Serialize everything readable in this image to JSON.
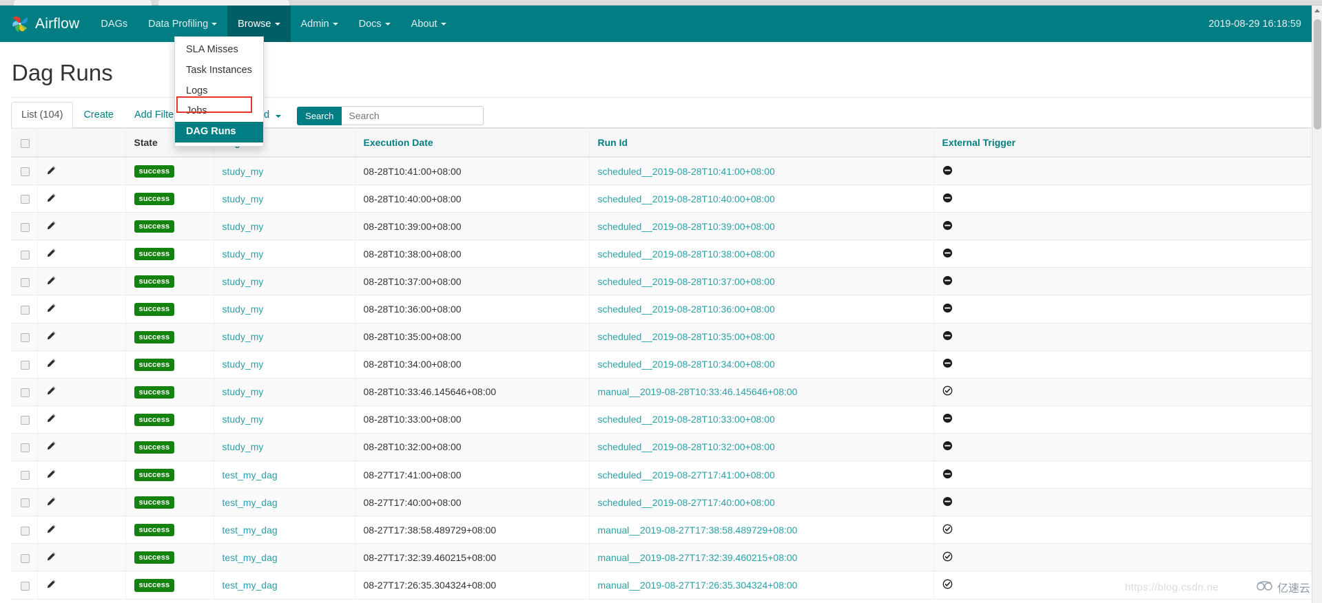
{
  "navbar": {
    "brand": "Airflow",
    "items": [
      {
        "label": "DAGs",
        "caret": false
      },
      {
        "label": "Data Profiling",
        "caret": true
      },
      {
        "label": "Browse",
        "caret": true,
        "open": true
      },
      {
        "label": "Admin",
        "caret": true
      },
      {
        "label": "Docs",
        "caret": true
      },
      {
        "label": "About",
        "caret": true
      }
    ],
    "clock": "2019-08-29 16:18:59",
    "brand_color": "#017e84",
    "brand_open_color": "#005f66"
  },
  "dropdown": {
    "items": [
      {
        "label": "SLA Misses",
        "active": false
      },
      {
        "label": "Task Instances",
        "active": false
      },
      {
        "label": "Logs",
        "active": false
      },
      {
        "label": "Jobs",
        "active": false
      },
      {
        "label": "DAG Runs",
        "active": true
      }
    ],
    "highlight_color": "#e8352c"
  },
  "page": {
    "title": "Dag Runs"
  },
  "toolbar": {
    "tabs": [
      {
        "label": "List (104)",
        "active": true,
        "caret": false
      },
      {
        "label": "Create",
        "active": false,
        "caret": false
      },
      {
        "label": "Add Filter",
        "active": false,
        "caret": true
      },
      {
        "label": "With selected",
        "active": false,
        "caret": true
      }
    ],
    "search_button_label": "Search",
    "search_placeholder": "Search",
    "search_value": ""
  },
  "table": {
    "columns": [
      {
        "key": "check",
        "label": "",
        "sortable": false
      },
      {
        "key": "edit",
        "label": "",
        "sortable": false
      },
      {
        "key": "state",
        "label": "State",
        "sortable": false
      },
      {
        "key": "dag_id",
        "label": "Dag Id",
        "sortable": true
      },
      {
        "key": "execution_date",
        "label": "Execution Date",
        "sortable": true
      },
      {
        "key": "run_id",
        "label": "Run Id",
        "sortable": true
      },
      {
        "key": "external_trigger",
        "label": "External Trigger",
        "sortable": true
      }
    ],
    "rows": [
      {
        "state": "success",
        "dag_id": "study_my",
        "execution_date": "08-28T10:41:00+08:00",
        "run_id": "scheduled__2019-08-28T10:41:00+08:00",
        "external_trigger": "false"
      },
      {
        "state": "success",
        "dag_id": "study_my",
        "execution_date": "08-28T10:40:00+08:00",
        "run_id": "scheduled__2019-08-28T10:40:00+08:00",
        "external_trigger": "false"
      },
      {
        "state": "success",
        "dag_id": "study_my",
        "execution_date": "08-28T10:39:00+08:00",
        "run_id": "scheduled__2019-08-28T10:39:00+08:00",
        "external_trigger": "false"
      },
      {
        "state": "success",
        "dag_id": "study_my",
        "execution_date": "08-28T10:38:00+08:00",
        "run_id": "scheduled__2019-08-28T10:38:00+08:00",
        "external_trigger": "false"
      },
      {
        "state": "success",
        "dag_id": "study_my",
        "execution_date": "08-28T10:37:00+08:00",
        "run_id": "scheduled__2019-08-28T10:37:00+08:00",
        "external_trigger": "false"
      },
      {
        "state": "success",
        "dag_id": "study_my",
        "execution_date": "08-28T10:36:00+08:00",
        "run_id": "scheduled__2019-08-28T10:36:00+08:00",
        "external_trigger": "false"
      },
      {
        "state": "success",
        "dag_id": "study_my",
        "execution_date": "08-28T10:35:00+08:00",
        "run_id": "scheduled__2019-08-28T10:35:00+08:00",
        "external_trigger": "false"
      },
      {
        "state": "success",
        "dag_id": "study_my",
        "execution_date": "08-28T10:34:00+08:00",
        "run_id": "scheduled__2019-08-28T10:34:00+08:00",
        "external_trigger": "false"
      },
      {
        "state": "success",
        "dag_id": "study_my",
        "execution_date": "08-28T10:33:46.145646+08:00",
        "run_id": "manual__2019-08-28T10:33:46.145646+08:00",
        "external_trigger": "true"
      },
      {
        "state": "success",
        "dag_id": "study_my",
        "execution_date": "08-28T10:33:00+08:00",
        "run_id": "scheduled__2019-08-28T10:33:00+08:00",
        "external_trigger": "false"
      },
      {
        "state": "success",
        "dag_id": "study_my",
        "execution_date": "08-28T10:32:00+08:00",
        "run_id": "scheduled__2019-08-28T10:32:00+08:00",
        "external_trigger": "false"
      },
      {
        "state": "success",
        "dag_id": "test_my_dag",
        "execution_date": "08-27T17:41:00+08:00",
        "run_id": "scheduled__2019-08-27T17:41:00+08:00",
        "external_trigger": "false"
      },
      {
        "state": "success",
        "dag_id": "test_my_dag",
        "execution_date": "08-27T17:40:00+08:00",
        "run_id": "scheduled__2019-08-27T17:40:00+08:00",
        "external_trigger": "false"
      },
      {
        "state": "success",
        "dag_id": "test_my_dag",
        "execution_date": "08-27T17:38:58.489729+08:00",
        "run_id": "manual__2019-08-27T17:38:58.489729+08:00",
        "external_trigger": "true"
      },
      {
        "state": "success",
        "dag_id": "test_my_dag",
        "execution_date": "08-27T17:32:39.460215+08:00",
        "run_id": "manual__2019-08-27T17:32:39.460215+08:00",
        "external_trigger": "true"
      },
      {
        "state": "success",
        "dag_id": "test_my_dag",
        "execution_date": "08-27T17:26:35.304324+08:00",
        "run_id": "manual__2019-08-27T17:26:35.304324+08:00",
        "external_trigger": "true"
      }
    ],
    "state_badge_color": "#14820f",
    "link_color": "#2a9fa8"
  },
  "watermark": {
    "url": "https://blog.csdn.ne",
    "badge": "亿速云"
  }
}
